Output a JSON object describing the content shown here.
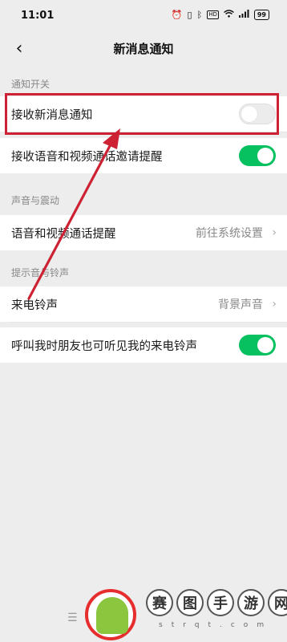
{
  "status_bar": {
    "time": "11:01",
    "icons": [
      "alarm-icon",
      "vibrate-icon",
      "bluetooth-icon",
      "hd-icon",
      "wifi-icon",
      "signal-icon",
      "battery-icon"
    ],
    "hd_label": "HD",
    "battery": "99"
  },
  "nav": {
    "back_glyph": "‹",
    "title": "新消息通知"
  },
  "sections": {
    "notify_switch": {
      "header": "通知开关",
      "rows": [
        {
          "label": "接收新消息通知",
          "toggle_on": false
        },
        {
          "label": "接收语音和视频通话邀请提醒",
          "toggle_on": true
        }
      ]
    },
    "sound_vibrate": {
      "header": "声音与震动",
      "rows": [
        {
          "label": "语音和视频通话提醒",
          "value": "前往系统设置"
        }
      ]
    },
    "ringtone": {
      "header": "提示音与铃声",
      "rows": [
        {
          "label": "来电铃声",
          "value": "背景声音"
        },
        {
          "label": "呼叫我时朋友也可听见我的来电铃声",
          "toggle_on": true
        }
      ]
    }
  },
  "colors": {
    "accent_green": "#07c160",
    "highlight_red": "#cc2233",
    "background": "#ededed"
  },
  "watermark": {
    "chars": [
      "赛",
      "图",
      "手",
      "游",
      "网"
    ],
    "sub": "strqt.com"
  }
}
